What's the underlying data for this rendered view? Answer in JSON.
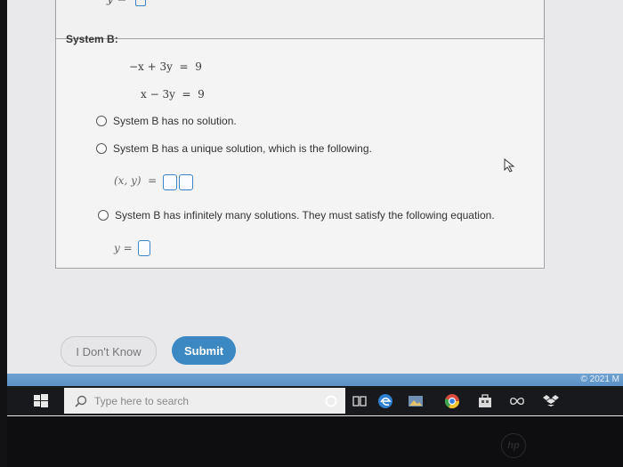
{
  "top_fragment": {
    "var": "y ="
  },
  "system": {
    "title": "System B:",
    "equations": [
      "−x + 3y  =  9",
      "x − 3y  =  9"
    ]
  },
  "options": [
    {
      "label": "System B has no solution."
    },
    {
      "label": "System B has a unique solution, which is the following."
    },
    {
      "label": "System B has infinitely many solutions. They must satisfy the following equation."
    }
  ],
  "unique_solution": {
    "prefix": "(x, y)  ="
  },
  "infinite_solution": {
    "prefix": "y ="
  },
  "buttons": {
    "dont_know": "I Don't Know",
    "submit": "Submit"
  },
  "footer": {
    "copyright": "© 2021 M"
  },
  "taskbar": {
    "search_placeholder": "Type here to search",
    "icons": [
      "windows-start-icon",
      "cortana-icon",
      "task-view-icon",
      "edge-icon",
      "photos-icon",
      "chrome-icon",
      "store-icon",
      "infinity-icon",
      "dropbox-icon"
    ]
  },
  "brand": {
    "laptop_logo": "hp"
  },
  "colors": {
    "accent": "#3b88c2",
    "input_border": "#3a85c9",
    "taskbar": "#18191c"
  }
}
